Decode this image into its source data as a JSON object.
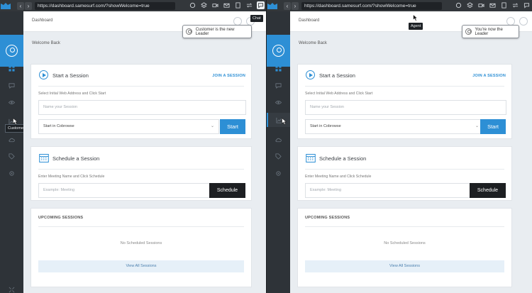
{
  "browser": {
    "url": "https://dashboard.samesurf.com/?showWelcome=true",
    "back_glyph": "‹",
    "forward_glyph": "›"
  },
  "tooltips": {
    "chat": "Chat",
    "agent": "Agent",
    "customer": "Customer"
  },
  "toasts": {
    "left": "Customer is the new Leader",
    "right": "You're now the Leader"
  },
  "dashboard": {
    "breadcrumb": "Dashboard",
    "welcome": "Welcome Back",
    "start_session": {
      "title": "Start a Session",
      "join_link": "JOIN A SESSION",
      "hint": "Select Initial Web Address and Click Start",
      "name_placeholder": "Name your Session",
      "mode_value": "Start in Cobrowse",
      "start_label": "Start"
    },
    "schedule": {
      "title": "Schedule a Session",
      "hint": "Enter Meeting Name and Click Schedule",
      "placeholder": "Example: Meeting",
      "schedule_label": "Schedule"
    },
    "upcoming": {
      "title": "UPCOMING SESSIONS",
      "empty": "No Scheduled Sessions",
      "view_all": "View All Sessions"
    }
  },
  "colors": {
    "accent": "#2d8fd5",
    "sidebar": "#2e3338",
    "topbar": "#33373b",
    "schedule_button": "#1d1f22"
  },
  "icons": {
    "sidebar": [
      "dashboard-grid-icon",
      "chat-icon",
      "eye-icon",
      "analytics-icon",
      "cloud-icon",
      "tag-icon",
      "settings-icon"
    ]
  }
}
